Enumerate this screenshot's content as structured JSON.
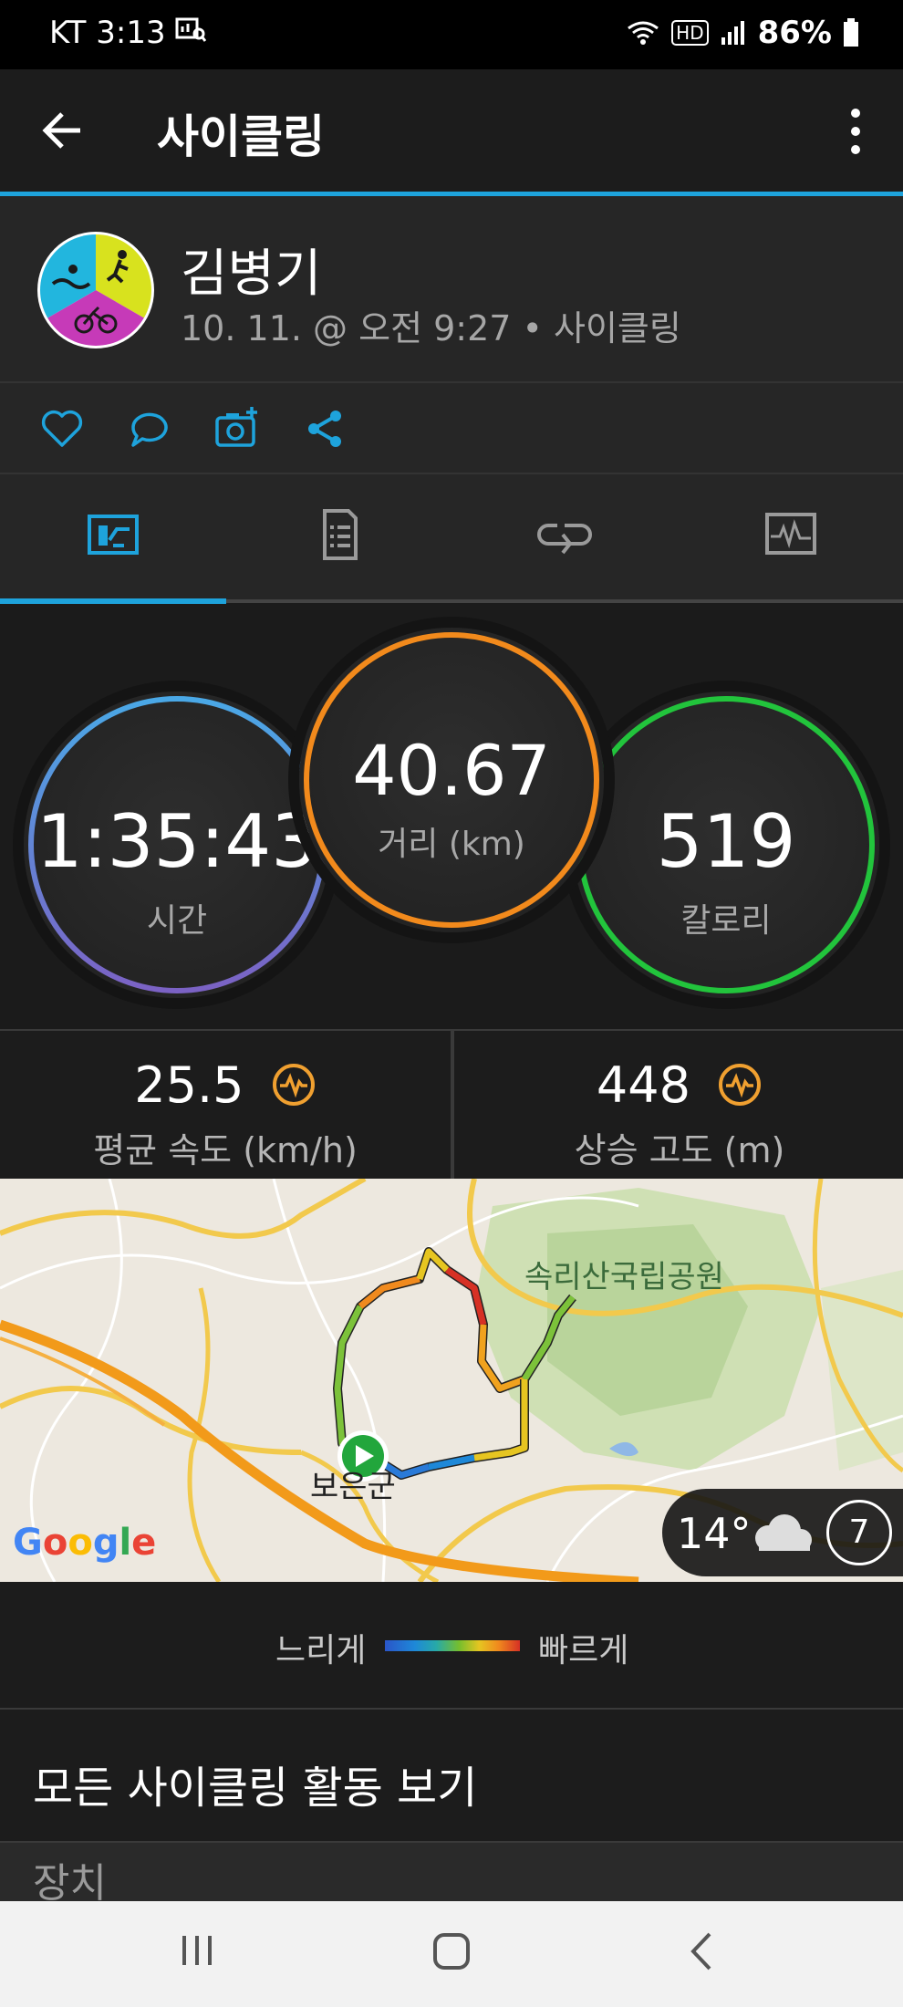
{
  "status_bar": {
    "carrier": "KT",
    "time": "3:13",
    "hd_label": "HD",
    "battery": "86%"
  },
  "app_bar": {
    "title": "사이클링"
  },
  "activity": {
    "user_name": "김병기",
    "meta": "10. 11. @ 오전 9:27 • 사이클링"
  },
  "summary": {
    "time_value": "1:35:43",
    "time_label": "시간",
    "distance_value": "40.67",
    "distance_label": "거리 (km)",
    "calories_value": "519",
    "calories_label": "칼로리"
  },
  "metrics": {
    "avg_speed_value": "25.5",
    "avg_speed_label": "평균 속도 (km/h)",
    "ascent_value": "448",
    "ascent_label": "상승 고도 (m)"
  },
  "map": {
    "park_label": "속리산국립공원",
    "town_label": "보은군",
    "google_logo": "Google",
    "temperature": "14°",
    "moon_phase": "7"
  },
  "legend": {
    "slow": "느리게",
    "fast": "빠르게"
  },
  "links": {
    "all_activities": "모든 사이클링 활동 보기",
    "device_section": "장치"
  },
  "colors": {
    "accent_blue": "#1ea3dc",
    "time_ring": "#4da6e6",
    "distance_ring": "#f28a1c",
    "calories_ring": "#22c43c",
    "connect_iq_icon": "#f0a030"
  }
}
